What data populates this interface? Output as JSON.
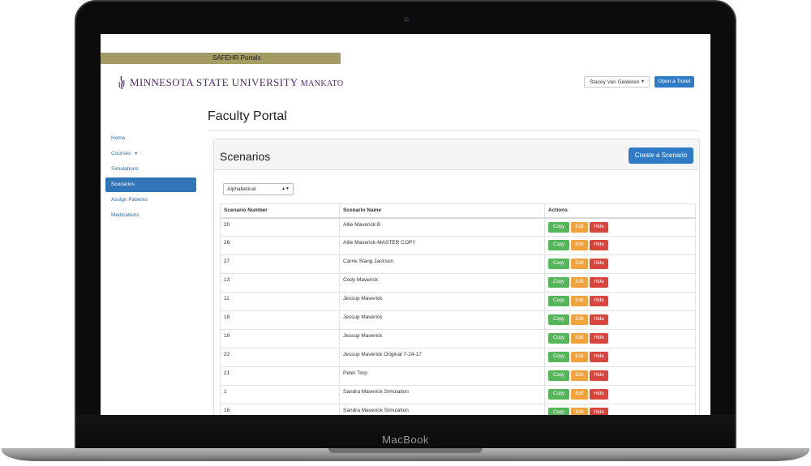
{
  "device": {
    "brand": "MacBook"
  },
  "header": {
    "portal_label": "SAFEHR Portals",
    "logo_text_main": "MINNESOTA STATE UNIVERSITY",
    "logo_text_suffix": "MANKATO",
    "user_name": "Stacey Van Gelderen",
    "ticket_label": "Open a Ticket"
  },
  "sidebar": {
    "items": [
      {
        "label": "Home",
        "active": false
      },
      {
        "label": "Courses",
        "active": false
      },
      {
        "label": "Simulations",
        "active": false
      },
      {
        "label": "Scenarios",
        "active": true
      },
      {
        "label": "Assign Patients",
        "active": false
      },
      {
        "label": "Medications",
        "active": false
      }
    ]
  },
  "main": {
    "page_title": "Faculty Portal",
    "panel_title": "Scenarios",
    "create_label": "Create a Scenario",
    "sort_value": "Alphabetical",
    "table": {
      "headers": [
        "Scenario Number",
        "Scenario Name",
        "Actions"
      ],
      "action_labels": {
        "copy": "Copy",
        "edit": "Edit",
        "hide": "Hide"
      },
      "rows": [
        {
          "number": "20",
          "name": "Allie Maverick B"
        },
        {
          "number": "26",
          "name": "Allie Maverick-MASTER COPY"
        },
        {
          "number": "27",
          "name": "Carrie Stang Jackson"
        },
        {
          "number": "13",
          "name": "Cody Maverick"
        },
        {
          "number": "11",
          "name": "Jessup Maverick"
        },
        {
          "number": "18",
          "name": "Jessup Maverick"
        },
        {
          "number": "19",
          "name": "Jessup Maverick"
        },
        {
          "number": "22",
          "name": "Jessup Maverick Original 7-24-17"
        },
        {
          "number": "21",
          "name": "Peter Torp"
        },
        {
          "number": "1",
          "name": "Sandra Maverick Simulation"
        },
        {
          "number": "16",
          "name": "Sandra Maverick Simulation"
        }
      ]
    }
  },
  "colors": {
    "portal_bar": "#a39a64",
    "logo_purple": "#4e2a6e",
    "primary_blue": "#2f7bc5",
    "copy_green": "#55b559",
    "edit_orange": "#f0a23c",
    "hide_red": "#d8453e"
  }
}
